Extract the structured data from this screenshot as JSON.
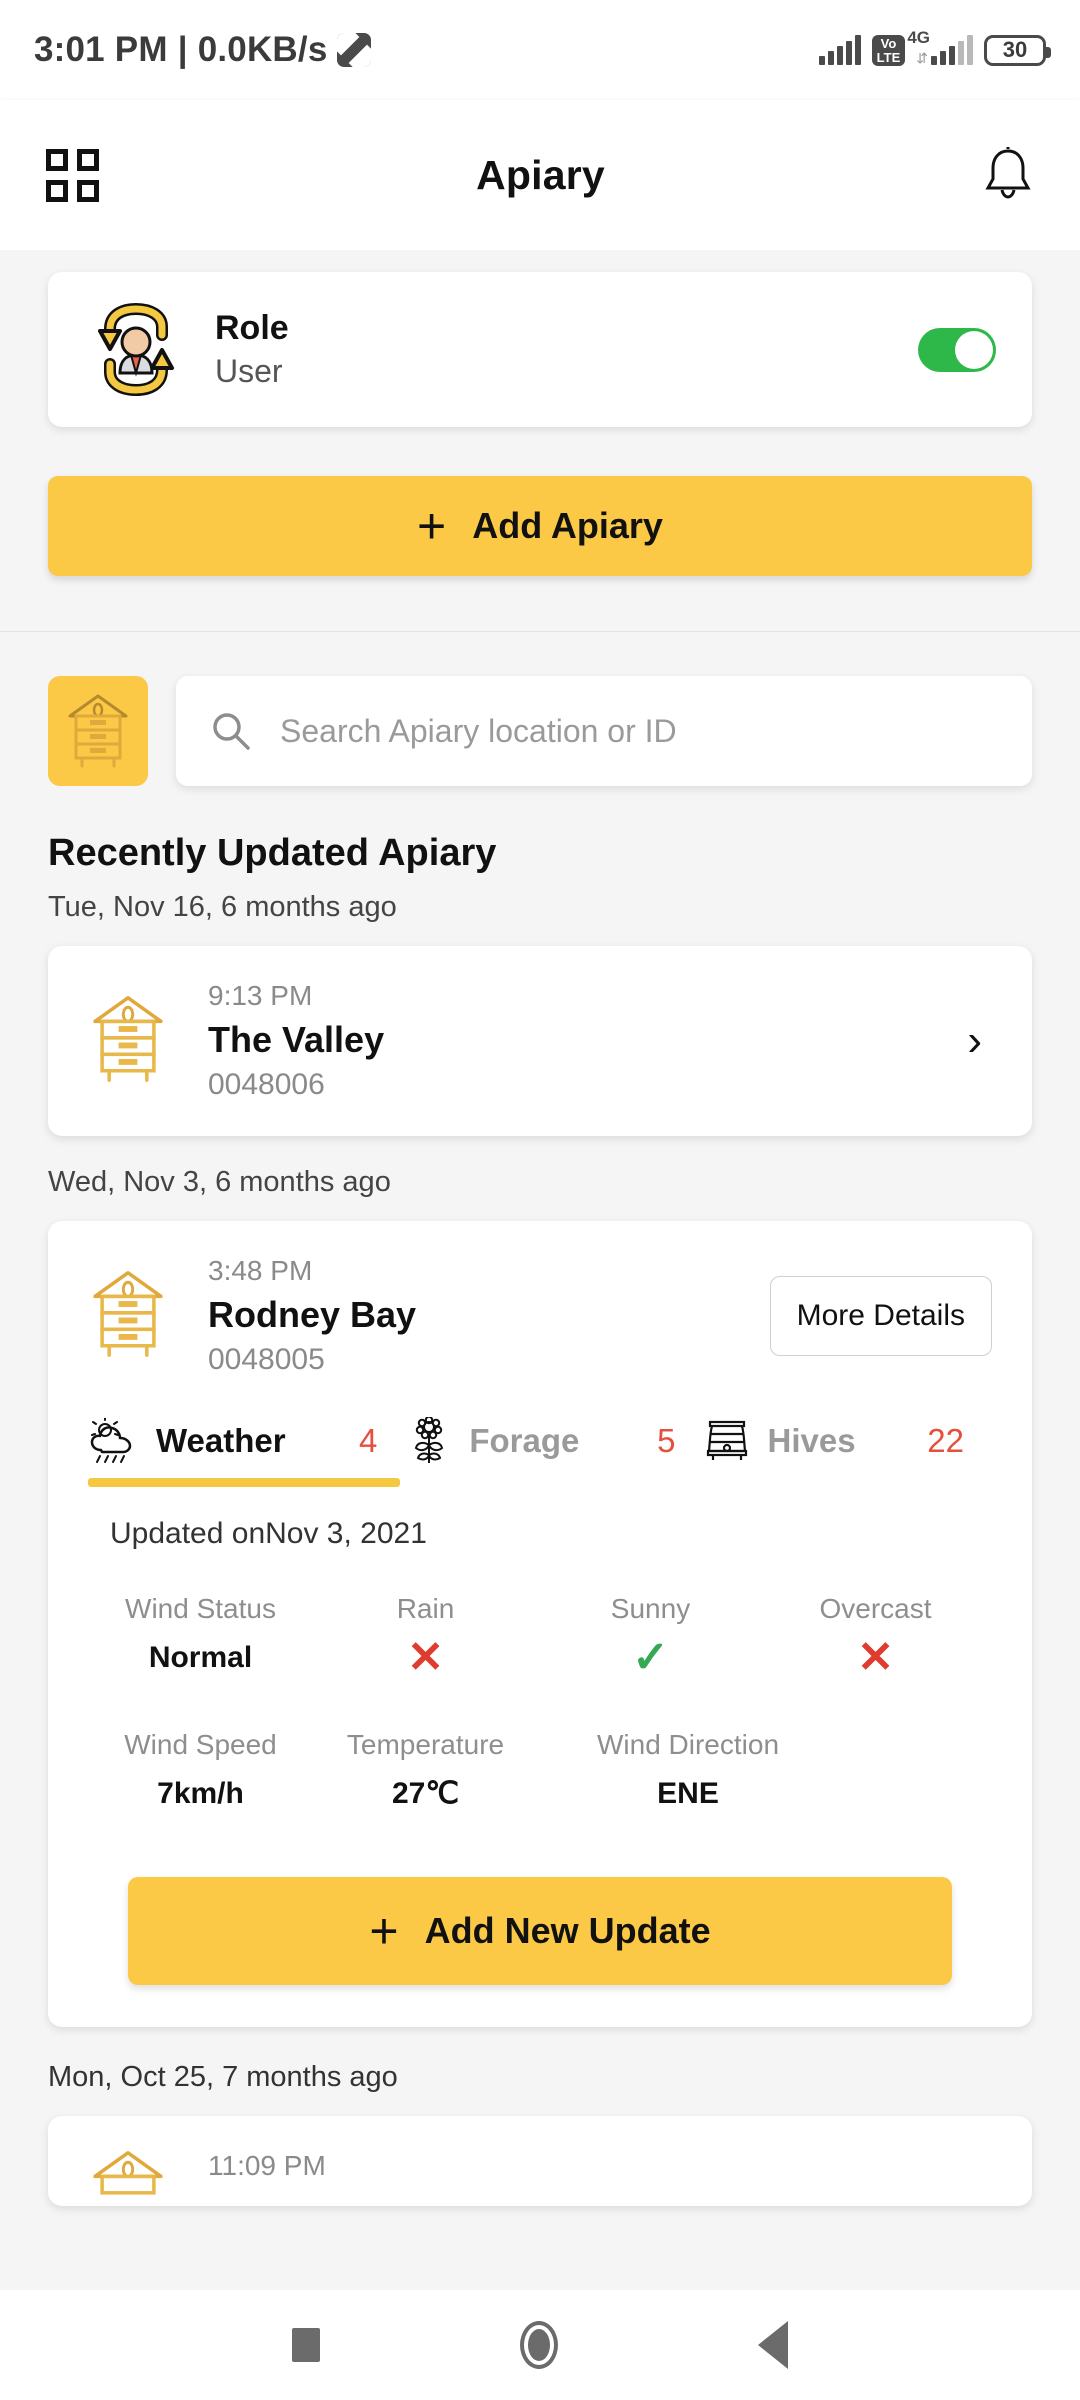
{
  "status_bar": {
    "clock": "3:01 PM",
    "separator": "|",
    "net_speed": "0.0KB/s",
    "net_speed_icon": "data-transfer-icon",
    "signal_icon": "signal-bars-icon",
    "volte_top": "Vo",
    "volte_bottom": "LTE",
    "network_type": "4G",
    "battery_level": "30"
  },
  "app_bar": {
    "menu_icon": "grid-menu-icon",
    "title": "Apiary",
    "notification_icon": "bell-icon"
  },
  "role_card": {
    "icon": "role-switch-icon",
    "title": "Role",
    "value": "User",
    "toggle_state": "on",
    "toggle_color": "#2fb84a"
  },
  "add_apiary_button": {
    "plus": "+",
    "label": "Add Apiary",
    "color": "#FBC946"
  },
  "search": {
    "hive_icon": "beehive-icon",
    "search_icon": "search-icon",
    "placeholder": "Search Apiary location or ID",
    "value": ""
  },
  "section": {
    "heading": "Recently Updated Apiary"
  },
  "groups": [
    {
      "date": "Tue, Nov 16,  6 months ago",
      "item": {
        "time": "9:13 PM",
        "name": "The Valley",
        "id": "0048006",
        "chevron": "›"
      }
    },
    {
      "date": "Wed, Nov 3,  6 months ago",
      "item": {
        "time": "3:48 PM",
        "name": "Rodney Bay",
        "id": "0048005",
        "more_details": "More Details"
      }
    },
    {
      "date": "Mon, Oct 25,  7 months ago",
      "item": {
        "time": "11:09 PM"
      }
    }
  ],
  "detail_tabs": [
    {
      "icon": "weather-cloud-sun-rain-icon",
      "label": "Weather",
      "count": "4",
      "active": true
    },
    {
      "icon": "forage-flower-icon",
      "label": "Forage",
      "count": "5",
      "active": false
    },
    {
      "icon": "hives-box-icon",
      "label": "Hives",
      "count": "22",
      "active": false
    }
  ],
  "weather_panel": {
    "updated_on": "Updated onNov 3, 2021",
    "row1": [
      {
        "key": "Wind Status",
        "value": "Normal",
        "type": "text"
      },
      {
        "key": "Rain",
        "value": "✕",
        "type": "no"
      },
      {
        "key": "Sunny",
        "value": "✓",
        "type": "yes"
      },
      {
        "key": "Overcast",
        "value": "✕",
        "type": "no"
      }
    ],
    "row2": [
      {
        "key": "Wind Speed",
        "value": "7km/h",
        "type": "text"
      },
      {
        "key": "Temperature",
        "value": "27℃",
        "type": "text"
      },
      {
        "key": "Wind Direction",
        "value": "ENE",
        "type": "text"
      }
    ],
    "add_update_button": {
      "plus": "+",
      "label": "Add New Update"
    }
  },
  "nav_bar": {
    "recents_icon": "square-recents-icon",
    "home_icon": "circle-home-icon",
    "back_icon": "triangle-back-icon"
  },
  "accent_colors": {
    "yellow": "#FBC946",
    "tab_underline": "#F5C842",
    "count_red": "#e4503c",
    "check_green": "#34a853",
    "cross_red": "#e03b2f"
  }
}
